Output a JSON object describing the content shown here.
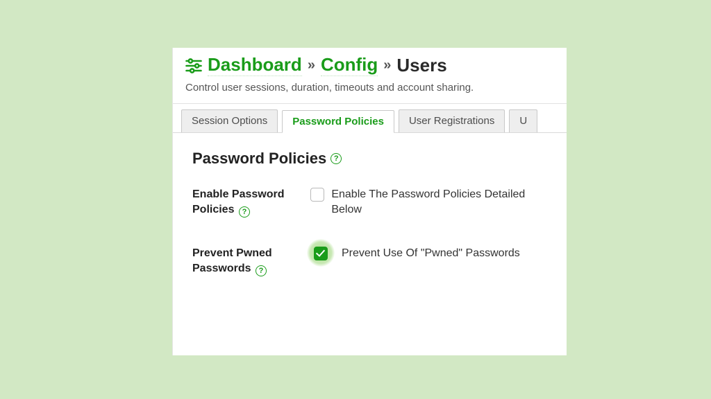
{
  "header": {
    "breadcrumb": {
      "dashboard": "Dashboard",
      "config": "Config",
      "current": "Users"
    },
    "description": "Control user sessions, duration, timeouts and account sharing."
  },
  "tabs": {
    "session_options": "Session Options",
    "password_policies": "Password Policies",
    "user_registrations": "User Registrations",
    "partial_next": "U"
  },
  "section": {
    "title": "Password Policies"
  },
  "fields": {
    "enable": {
      "label": "Enable Password Policies",
      "control_label": "Enable The Password Policies Detailed Below",
      "checked": false
    },
    "pwned": {
      "label": "Prevent Pwned Passwords",
      "control_label": "Prevent Use Of \"Pwned\" Passwords",
      "checked": true
    }
  },
  "glyphs": {
    "help": "?",
    "sep": "»"
  }
}
